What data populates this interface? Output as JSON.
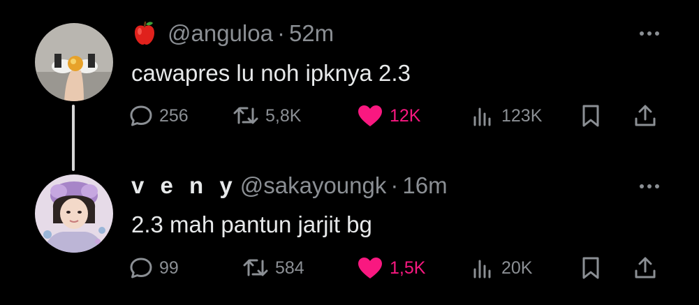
{
  "tweets": [
    {
      "name": "",
      "name_icon": "apple-icon",
      "handle": "@anguloa",
      "separator": "·",
      "time": "52m",
      "text": "cawapres lu noh ipknya 2.3",
      "replies": "256",
      "retweets": "5,8K",
      "likes": "12K",
      "views": "123K",
      "liked": true
    },
    {
      "name": "v e n y",
      "handle": "@sakayoungk",
      "separator": "·",
      "time": "16m",
      "text": "2.3 mah pantun jarjit bg",
      "replies": "99",
      "retweets": "584",
      "likes": "1,5K",
      "views": "20K",
      "liked": true
    }
  ],
  "colors": {
    "background": "#000000",
    "text": "#e7e9ea",
    "muted": "#8b8f94",
    "like": "#f91880"
  }
}
